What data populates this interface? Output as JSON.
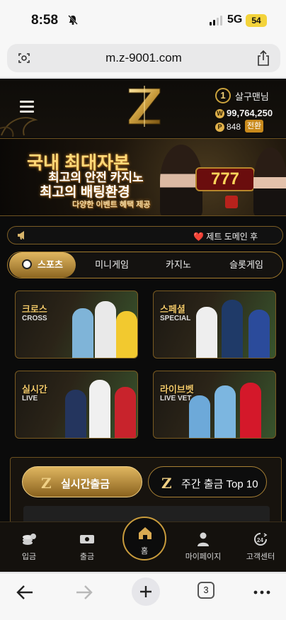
{
  "status_bar": {
    "time": "8:58",
    "network": "5G",
    "battery": "54"
  },
  "browser": {
    "url": "m.z-9001.com",
    "tab_count": "3"
  },
  "header": {
    "level": "1",
    "username": "살구맨님",
    "balance": "99,764,250",
    "balance_coin": "W",
    "points": "848",
    "points_coin": "P",
    "convert_label": "전환"
  },
  "banner": {
    "line1": "국내 최대자본",
    "line2": "최고의 안전 카지노",
    "line3": "최고의 배팅환경",
    "line4": "다양한 이벤트 혜택 제공",
    "slot_text": "777"
  },
  "notice": {
    "text": "❤️ 제트 도메인 후"
  },
  "tabs": [
    {
      "label": "스포츠",
      "active": true
    },
    {
      "label": "미니게임",
      "active": false
    },
    {
      "label": "카지노",
      "active": false
    },
    {
      "label": "슬롯게임",
      "active": false
    }
  ],
  "cards": [
    {
      "title": "크로스",
      "subtitle": "CROSS"
    },
    {
      "title": "스페셜",
      "subtitle": "SPECIAL"
    },
    {
      "title": "실시간",
      "subtitle": "LIVE"
    },
    {
      "title": "라이브벳",
      "subtitle": "LIVE VET"
    }
  ],
  "panel": {
    "live_withdraw": "실시간출금",
    "weekly_top": "주간 출금 Top 10"
  },
  "bottom_nav": {
    "deposit": "입금",
    "withdraw": "출금",
    "home": "홈",
    "mypage": "마이페이지",
    "support": "고객센터"
  },
  "colors": {
    "accent_gold": "#c89b3c",
    "background": "#0b0b0b"
  }
}
